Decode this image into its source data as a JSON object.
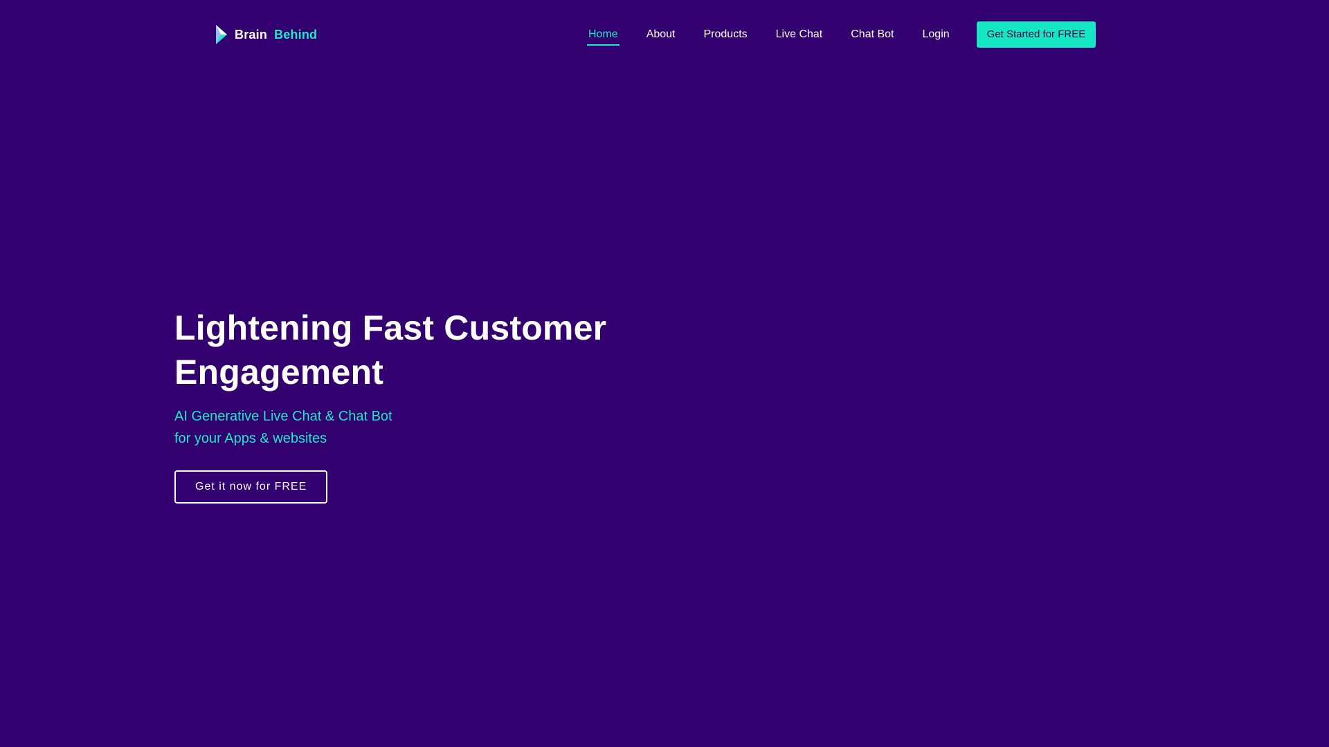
{
  "brand": {
    "name_part1": "Brain",
    "name_part2": "Behind",
    "logo_icon": "play-triangle-logo-icon"
  },
  "nav": {
    "items": [
      {
        "label": "Home",
        "active": true
      },
      {
        "label": "About",
        "active": false
      },
      {
        "label": "Products",
        "active": false
      },
      {
        "label": "Live Chat",
        "active": false
      },
      {
        "label": "Chat Bot",
        "active": false
      },
      {
        "label": "Login",
        "active": false
      }
    ],
    "cta_label": "Get Started for FREE"
  },
  "hero": {
    "title_line1": "Lightening Fast Customer",
    "title_line2": "Engagement",
    "subtitle_line1": "AI Generative Live Chat & Chat Bot",
    "subtitle_line2": "for your Apps & websites",
    "cta_label": "Get it now for FREE"
  },
  "colors": {
    "background": "#33006f",
    "accent": "#1ee9c9",
    "cta_fill": "#15e6c3",
    "text": "#ffffff"
  }
}
